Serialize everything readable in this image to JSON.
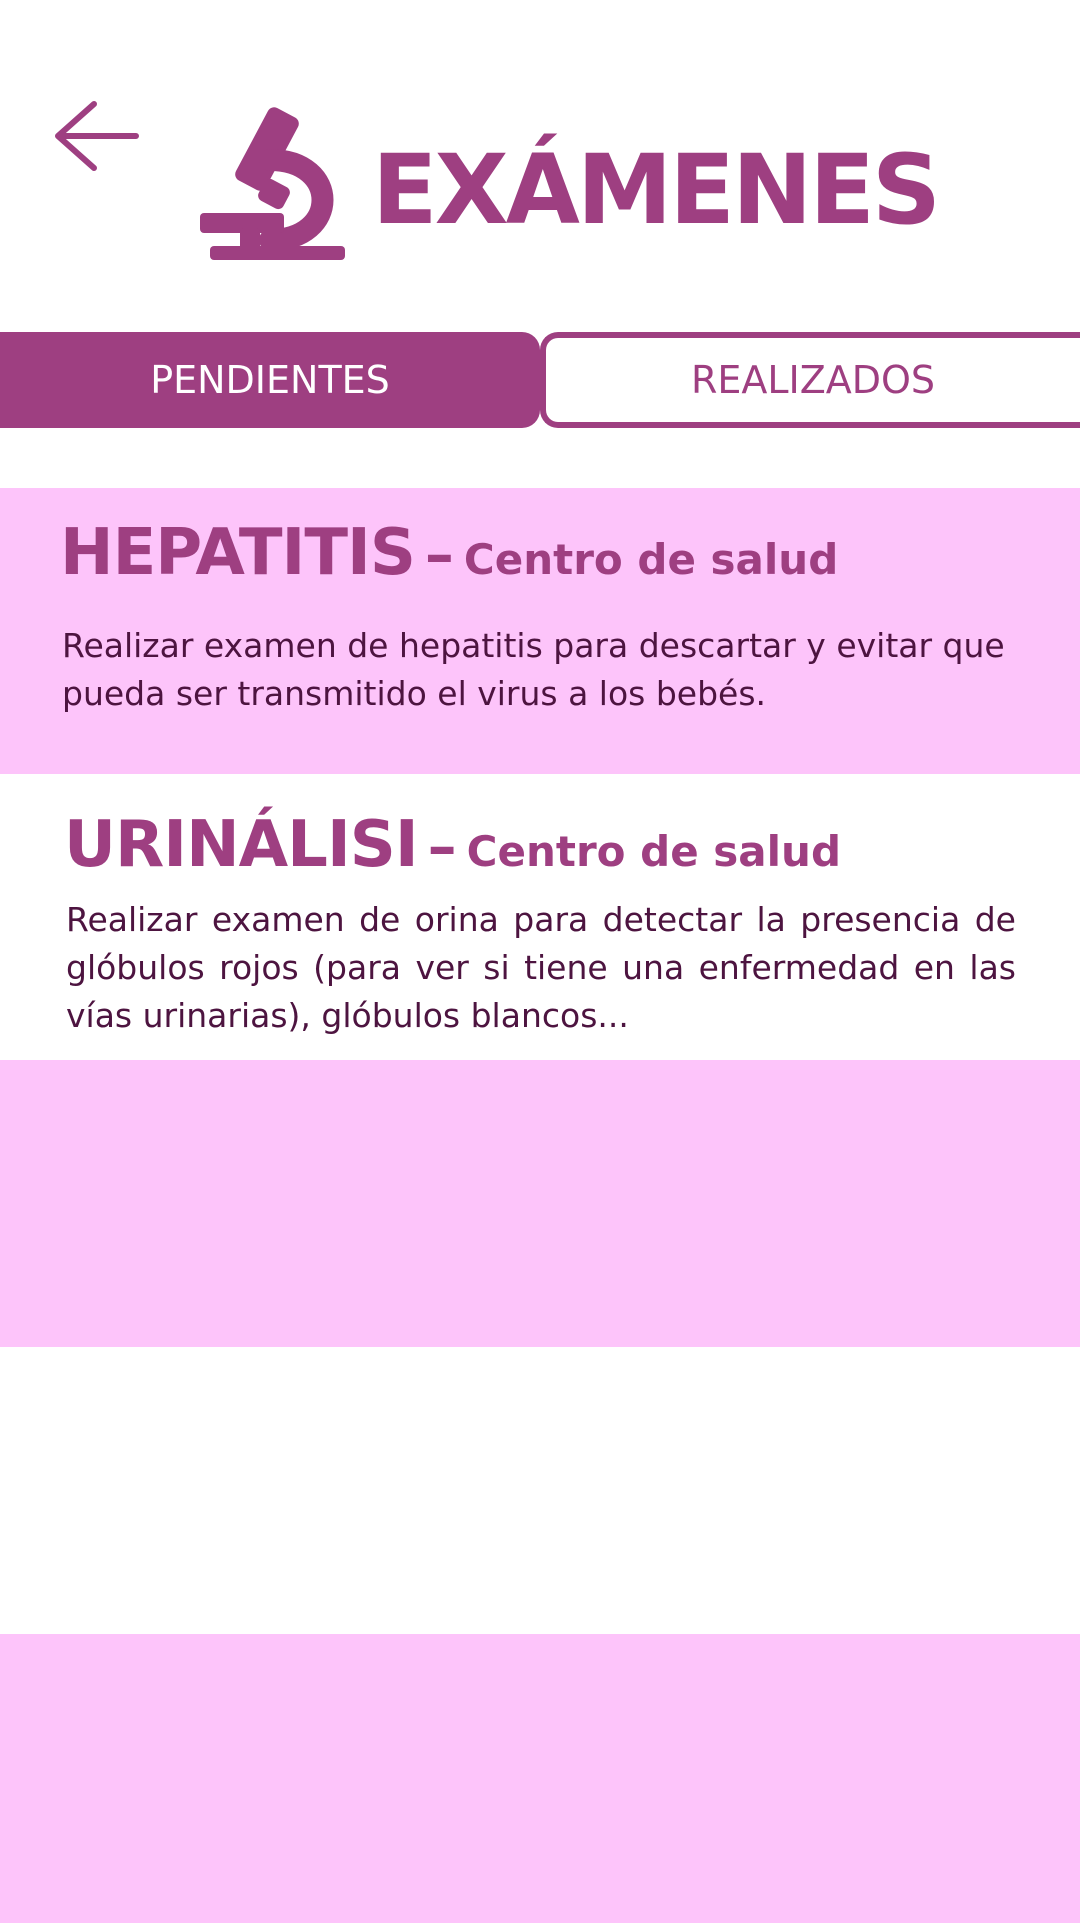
{
  "header": {
    "title": "EXÁMENES",
    "back_icon": "arrow-left-icon",
    "title_icon": "microscope-icon"
  },
  "tabs": [
    {
      "label": "PENDIENTES",
      "active": true
    },
    {
      "label": "REALIZADOS",
      "active": false
    }
  ],
  "exams": [
    {
      "name": "HEPATITIS",
      "separator": "–",
      "location": "Centro de salud",
      "description": "Realizar examen de hepatitis para descartar y evitar que pueda ser transmitido el virus a los bebés."
    },
    {
      "name": "URINÁLISI",
      "separator": "–",
      "location": "Centro de salud",
      "description": "Realizar examen de orina para detectar la presencia de glóbulos rojos (para ver si tiene una enfermedad en las vías urinarias), glóbulos blancos..."
    }
  ],
  "colors": {
    "accent": "#9e3f81",
    "card_pink": "#fdc4fa",
    "body_text": "#4d1440",
    "background": "#ffffff"
  }
}
